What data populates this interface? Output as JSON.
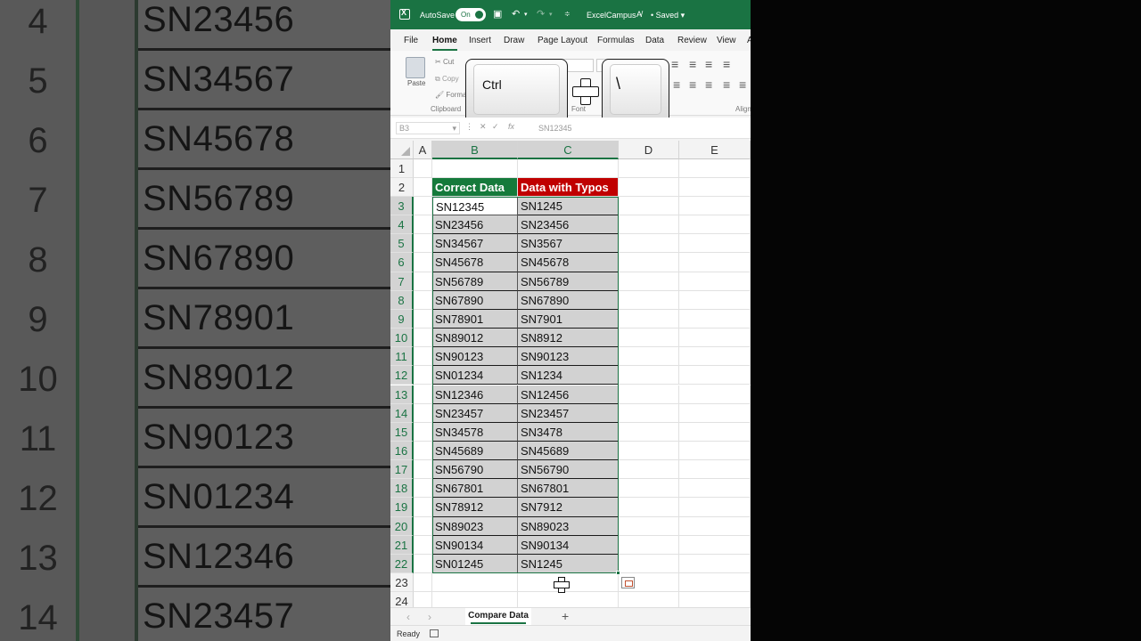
{
  "title_bar": {
    "autosave_label": "AutoSave",
    "autosave_state": "On",
    "document_title": "ExcelCampus",
    "saved_status": "• Saved",
    "accent_color": "#1a7343"
  },
  "ribbon_tabs": [
    "File",
    "Home",
    "Insert",
    "Draw",
    "Page Layout",
    "Formulas",
    "Data",
    "Review",
    "View"
  ],
  "active_tab": "Home",
  "ribbon": {
    "paste_label": "Paste",
    "cut_label": "Cut",
    "copy_label": "Copy",
    "format_label": "Forma",
    "clipboard_group": "Clipboard",
    "font_group": "Font",
    "alignment_group": "Align"
  },
  "shortcut_overlay": {
    "key1": "Ctrl",
    "key2": "\\"
  },
  "formula_bar": {
    "name_box": "B3",
    "fx": "fx",
    "value": "SN12345"
  },
  "columns": [
    "A",
    "B",
    "C",
    "D",
    "E"
  ],
  "headers": {
    "correct": "Correct Data",
    "typos": "Data with Typos",
    "correct_color": "#157a3b",
    "typos_color": "#c00000"
  },
  "rows": [
    {
      "n": "3",
      "b": "SN12345",
      "c": "SN1245"
    },
    {
      "n": "4",
      "b": "SN23456",
      "c": "SN23456"
    },
    {
      "n": "5",
      "b": "SN34567",
      "c": "SN3567"
    },
    {
      "n": "6",
      "b": "SN45678",
      "c": "SN45678"
    },
    {
      "n": "7",
      "b": "SN56789",
      "c": "SN56789"
    },
    {
      "n": "8",
      "b": "SN67890",
      "c": "SN67890"
    },
    {
      "n": "9",
      "b": "SN78901",
      "c": "SN7901"
    },
    {
      "n": "10",
      "b": "SN89012",
      "c": "SN8912"
    },
    {
      "n": "11",
      "b": "SN90123",
      "c": "SN90123"
    },
    {
      "n": "12",
      "b": "SN01234",
      "c": "SN1234"
    },
    {
      "n": "13",
      "b": "SN12346",
      "c": "SN12456"
    },
    {
      "n": "14",
      "b": "SN23457",
      "c": "SN23457"
    },
    {
      "n": "15",
      "b": "SN34578",
      "c": "SN3478"
    },
    {
      "n": "16",
      "b": "SN45689",
      "c": "SN45689"
    },
    {
      "n": "17",
      "b": "SN56790",
      "c": "SN56790"
    },
    {
      "n": "18",
      "b": "SN67801",
      "c": "SN67801"
    },
    {
      "n": "19",
      "b": "SN78912",
      "c": "SN7912"
    },
    {
      "n": "20",
      "b": "SN89023",
      "c": "SN89023"
    },
    {
      "n": "21",
      "b": "SN90134",
      "c": "SN90134"
    },
    {
      "n": "22",
      "b": "SN01245",
      "c": "SN1245"
    }
  ],
  "extra_rows": [
    "1",
    "2",
    "23",
    "24"
  ],
  "sheet_tab": "Compare Data",
  "status": "Ready",
  "background_zoom": [
    {
      "n": "4",
      "v": "SN23456"
    },
    {
      "n": "5",
      "v": "SN34567"
    },
    {
      "n": "6",
      "v": "SN45678"
    },
    {
      "n": "7",
      "v": "SN56789"
    },
    {
      "n": "8",
      "v": "SN67890"
    },
    {
      "n": "9",
      "v": "SN78901"
    },
    {
      "n": "10",
      "v": "SN89012"
    },
    {
      "n": "11",
      "v": "SN90123"
    },
    {
      "n": "12",
      "v": "SN01234"
    },
    {
      "n": "13",
      "v": "SN12346"
    },
    {
      "n": "14",
      "v": "SN23457"
    }
  ]
}
